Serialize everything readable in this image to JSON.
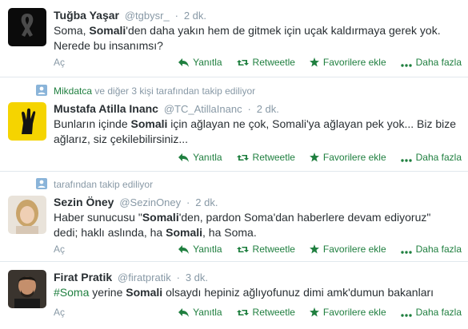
{
  "tweets": [
    {
      "fullname": "Tuğba Yaşar",
      "username": "@tgbysr_",
      "sep": "·",
      "time": "2 dk.",
      "text_parts": [
        {
          "t": "Soma, ",
          "b": false
        },
        {
          "t": "Somali",
          "b": true
        },
        {
          "t": "'den daha yakın hem de gitmek için uçak kaldırmaya gerek yok. Nerede bu insanımsı?",
          "b": false
        }
      ],
      "expand": "Aç",
      "avatar": "black-ribbon",
      "actions": [
        "Yanıtla",
        "Retweetle",
        "Favorilere ekle",
        "Daha fazla"
      ]
    },
    {
      "context_link": "Mikdatca",
      "context_rest": " ve diğer 3 kişi tarafından takip ediliyor",
      "fullname": "Mustafa Atilla Inanc",
      "username": "@TC_AtillaInanc",
      "sep": "·",
      "time": "2 dk.",
      "text_parts": [
        {
          "t": "Bunların içinde ",
          "b": false
        },
        {
          "t": "Somali",
          "b": true
        },
        {
          "t": " için ağlayan ne çok, Somali'ya ağlayan pek yok... Biz bize ağlarız, siz çekilebilirsiniz...",
          "b": false
        }
      ],
      "avatar": "yellow-hand",
      "actions": [
        "Yanıtla",
        "Retweetle",
        "Favorilere ekle",
        "Daha fazla"
      ]
    },
    {
      "context_rest": "tarafından takip ediliyor",
      "fullname": "Sezin Öney",
      "username": "@SezinOney",
      "sep": "·",
      "time": "2 dk.",
      "text_parts": [
        {
          "t": "Haber sunucusu \"",
          "b": false
        },
        {
          "t": "Somali",
          "b": true
        },
        {
          "t": "'den, pardon Soma'dan haberlere devam ediyoruz\" dedi; haklı aslında, ha ",
          "b": false
        },
        {
          "t": "Somali",
          "b": true
        },
        {
          "t": ", ha Soma.",
          "b": false
        }
      ],
      "expand": "Aç",
      "avatar": "woman-photo",
      "actions": [
        "Yanıtla",
        "Retweetle",
        "Favorilere ekle",
        "Daha fazla"
      ]
    },
    {
      "fullname": "Firat Pratik",
      "username": "@firatpratik",
      "sep": "·",
      "time": "3 dk.",
      "text_parts": [
        {
          "t": "#Soma",
          "b": false,
          "hashtag": true
        },
        {
          "t": " yerine ",
          "b": false
        },
        {
          "t": "Somali",
          "b": true
        },
        {
          "t": " olsaydı hepiniz ağlıyofunuz dimi amk'dumun bakanları",
          "b": false
        }
      ],
      "expand": "Aç",
      "avatar": "man-photo",
      "actions": [
        "Yanıtla",
        "Retweetle",
        "Favorilere ekle",
        "Daha fazla"
      ]
    }
  ],
  "colors": {
    "action": "#1f7f3f",
    "muted": "#8899a6",
    "text": "#292f33",
    "divider": "#e1e8ed"
  }
}
